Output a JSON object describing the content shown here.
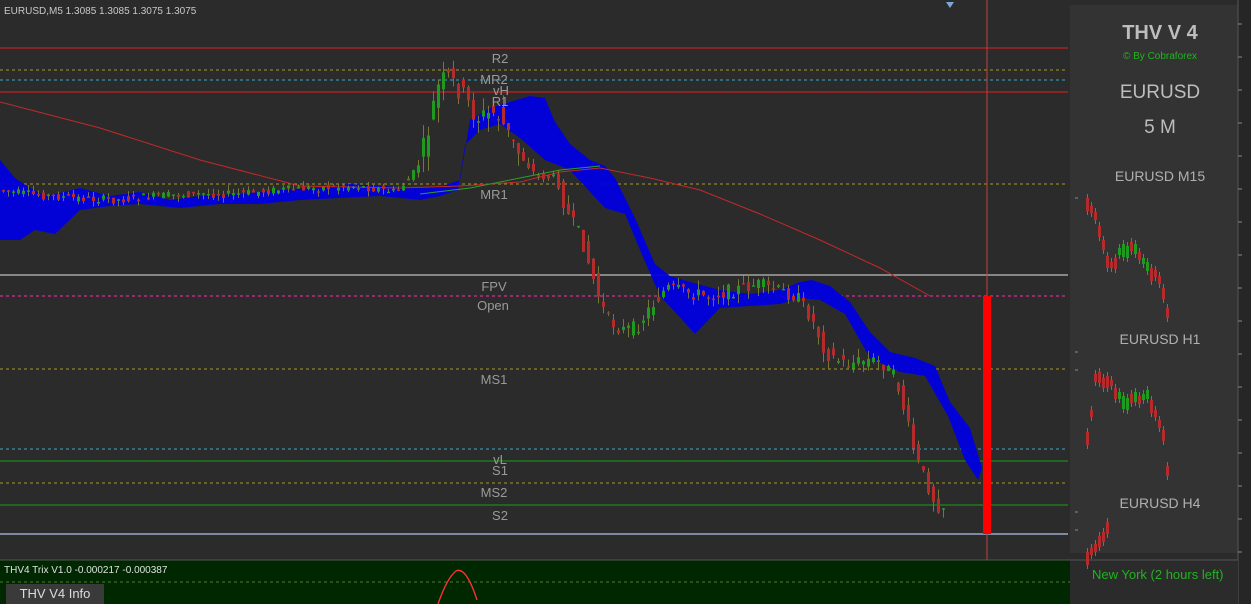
{
  "chart_header": {
    "text": "EURUSD,M5  1.3085 1.3085 1.3075 1.3075"
  },
  "levels": {
    "r2": "R2",
    "mr2": "MR2",
    "vh": "vH",
    "r1": "R1",
    "mr1": "MR1",
    "fpv": "FPV",
    "open": "Open",
    "ms1": "MS1",
    "vl": "vL",
    "s1": "S1",
    "ms2": "MS2",
    "s2": "S2"
  },
  "side_panel": {
    "title": "THV V 4",
    "byline": "© By Cobraforex",
    "symbol": "EURUSD",
    "timeframe": "5 M",
    "mini_charts": [
      {
        "label": "EURUSD M15"
      },
      {
        "label": "EURUSD H1"
      },
      {
        "label": "EURUSD H4"
      }
    ]
  },
  "subwindow": {
    "header": "THV4 Trix V1.0 -0.000217 -0.000387",
    "tab_label": "THV  V4  Info",
    "session": "New York    (2 hours left)"
  },
  "colors": {
    "background": "#2b2b2b",
    "panel": "#333333",
    "bull": "#1e9a1e",
    "bear": "#b52a2a",
    "cloud": "#0000e0",
    "resistance": "#c02020",
    "support": "#1a8a1a",
    "pivot_dotted": "#a89a20",
    "cyan_dotted": "#3aa8c8",
    "magenta_dotted": "#d0309a",
    "ma_line": "#c02a2a",
    "countdown_bar": "#ff0000",
    "subwindow_bg": "#002800"
  }
}
